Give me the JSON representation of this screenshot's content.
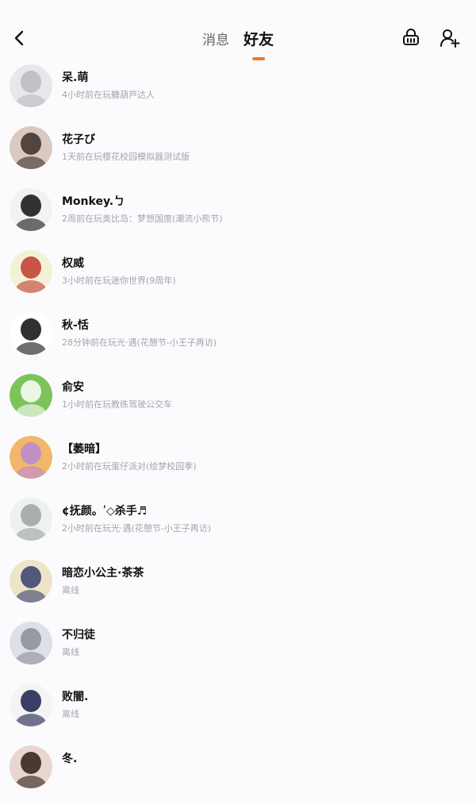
{
  "header": {
    "tabs": [
      {
        "label": "消息",
        "active": false
      },
      {
        "label": "好友",
        "active": true
      }
    ],
    "accent_color": "#f07a22",
    "icons": [
      "back-arrow-icon",
      "basket-icon",
      "add-friend-icon"
    ]
  },
  "friends": [
    {
      "name": "呆.萌",
      "status": "4小时前在玩糖葫芦达人",
      "avatar_colors": [
        "#e8e8ea",
        "#b9b9be"
      ]
    },
    {
      "name": "花子び",
      "status": "1天前在玩樱花校园模拟器测试版",
      "avatar_colors": [
        "#d9c9c0",
        "#3c2d28"
      ]
    },
    {
      "name": "Monkey.ㄅ",
      "status": "2周前在玩奥比岛：梦想国度(潮流小熊节)",
      "avatar_colors": [
        "#f2f2f2",
        "#111111"
      ]
    },
    {
      "name": "权威",
      "status": "3小时前在玩迷你世界(9周年)",
      "avatar_colors": [
        "#f5f1d8",
        "#c0392b"
      ]
    },
    {
      "name": "秋-恬",
      "status": "28分钟前在玩光·遇(花憩节-小王子再访)",
      "avatar_colors": [
        "#ffffff",
        "#0d0d10"
      ]
    },
    {
      "name": "俞安",
      "status": "1小时前在玩教练驾驶公交车",
      "avatar_colors": [
        "#7cc45a",
        "#ffffff"
      ]
    },
    {
      "name": "【萎暗】",
      "status": "2小时前在玩蛋仔派对(绘梦校园季)",
      "avatar_colors": [
        "#f3b76a",
        "#b98bd4"
      ]
    },
    {
      "name": "¢抚颜。ʹ◇杀手♬",
      "status": "2小时前在玩光·遇(花憩节-小王子再访)",
      "avatar_colors": [
        "#eef1f1",
        "#9aa3a3"
      ]
    },
    {
      "name": "暗恋小公主·茶茶",
      "status": "离线",
      "avatar_colors": [
        "#efe3c8",
        "#34406e"
      ]
    },
    {
      "name": "不归徒",
      "status": "离线",
      "avatar_colors": [
        "#dfe0e6",
        "#8b8d98"
      ]
    },
    {
      "name": "败闇.",
      "status": "离线",
      "avatar_colors": [
        "#f4f4f6",
        "#1b1e4a"
      ]
    },
    {
      "name": "冬.",
      "status": "",
      "avatar_colors": [
        "#e9d6cf",
        "#2b1d1a"
      ]
    }
  ]
}
